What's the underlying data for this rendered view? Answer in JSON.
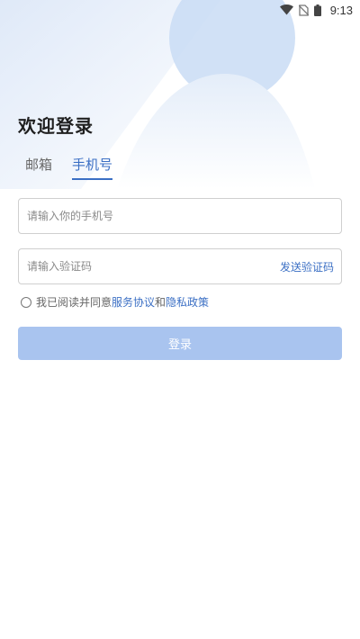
{
  "status_bar": {
    "time": "9:13",
    "icons": [
      "wifi-icon",
      "no-sim-icon",
      "battery-icon"
    ]
  },
  "page": {
    "title": "欢迎登录"
  },
  "tabs": [
    {
      "label": "邮箱",
      "active": false
    },
    {
      "label": "手机号",
      "active": true
    }
  ],
  "form": {
    "phone_placeholder": "请输入你的手机号",
    "phone_value": "",
    "code_placeholder": "请输入验证码",
    "code_value": "",
    "send_code_label": "发送验证码"
  },
  "agreement": {
    "checked": false,
    "prefix": "我已阅读并同意",
    "service_link": "服务协议",
    "conjunction": "和",
    "privacy_link": "隐私政策"
  },
  "login_button": {
    "label": "登录",
    "enabled": false
  },
  "colors": {
    "accent": "#3b6fc4",
    "button_disabled": "#a9c4ef",
    "hero_light": "#e9f0fb",
    "hero_mid": "#c9dcf5"
  }
}
